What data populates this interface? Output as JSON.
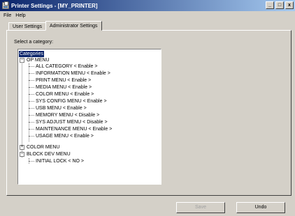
{
  "window": {
    "title": "Printer Settings - [MY_PRINTER]",
    "controls": {
      "minimize": "_",
      "maximize": "□",
      "close": "x"
    }
  },
  "menubar": {
    "file": "File",
    "help": "Help"
  },
  "tabs": [
    {
      "label": "User Settings",
      "active": false
    },
    {
      "label": "Administrator Settings",
      "active": true
    }
  ],
  "panel": {
    "select_label": "Select a category:"
  },
  "tree": {
    "root": "Categories",
    "op_menu": {
      "label": "OP MENU",
      "items": [
        "ALL CATEGORY < Enable >",
        "INFORMATION MENU < Enable >",
        "PRINT MENU < Enable >",
        "MEDIA MENU < Enable >",
        "COLOR MENU < Enable >",
        "SYS CONFIG MENU < Enable >",
        "USB MENU < Enable >",
        "MEMORY MENU < Disable >",
        "SYS ADJUST MENU < Disable >",
        "MAINTENANCE MENU < Enable >",
        "USAGE MENU < Enable >"
      ]
    },
    "color_menu": {
      "label": "COLOR MENU"
    },
    "block_dev_menu": {
      "label": "BLOCK DEV MENU",
      "items": [
        "INITIAL LOCK < NO >"
      ]
    }
  },
  "buttons": {
    "save": "Save",
    "undo": "Undo"
  }
}
